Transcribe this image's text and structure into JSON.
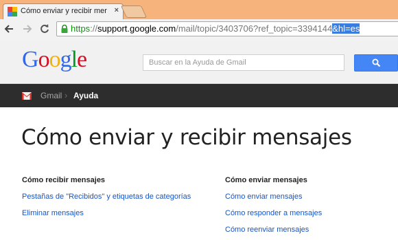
{
  "browser": {
    "tab_title": "Cómo enviar y recibir mer",
    "tab_close": "×",
    "url_scheme": "https",
    "url_sep": "://",
    "url_host": "support.google.com",
    "url_path": "/mail/topic/3403706?ref_topic=3394144",
    "url_selected": "&hl=es"
  },
  "header": {
    "logo_letters": [
      {
        "ch": "G",
        "color": "#3369e8"
      },
      {
        "ch": "o",
        "color": "#d50f25"
      },
      {
        "ch": "o",
        "color": "#eeb211"
      },
      {
        "ch": "g",
        "color": "#3369e8"
      },
      {
        "ch": "l",
        "color": "#009925"
      },
      {
        "ch": "e",
        "color": "#d50f25"
      }
    ],
    "search_placeholder": "Buscar en la Ayuda de Gmail",
    "search_icon": "search-icon"
  },
  "breadcrumb": {
    "icon": "gmail-icon",
    "gmail": "Gmail",
    "separator": "›",
    "current": "Ayuda"
  },
  "main": {
    "title": "Cómo enviar y recibir mensajes",
    "sections": [
      {
        "heading": "Cómo recibir mensajes",
        "links": [
          "Pestañas de \"Recibidos\" y etiquetas de categorías",
          "Eliminar mensajes"
        ]
      },
      {
        "heading": "Cómo enviar mensajes",
        "links": [
          "Cómo enviar mensajes",
          "Cómo responder a mensajes",
          "Cómo reenviar mensajes"
        ]
      }
    ]
  },
  "colors": {
    "tabstrip": "#f6b47c",
    "link": "#1155cc",
    "search_button": "#4486f6",
    "breadcrumb_bar": "#2d2d2d"
  }
}
